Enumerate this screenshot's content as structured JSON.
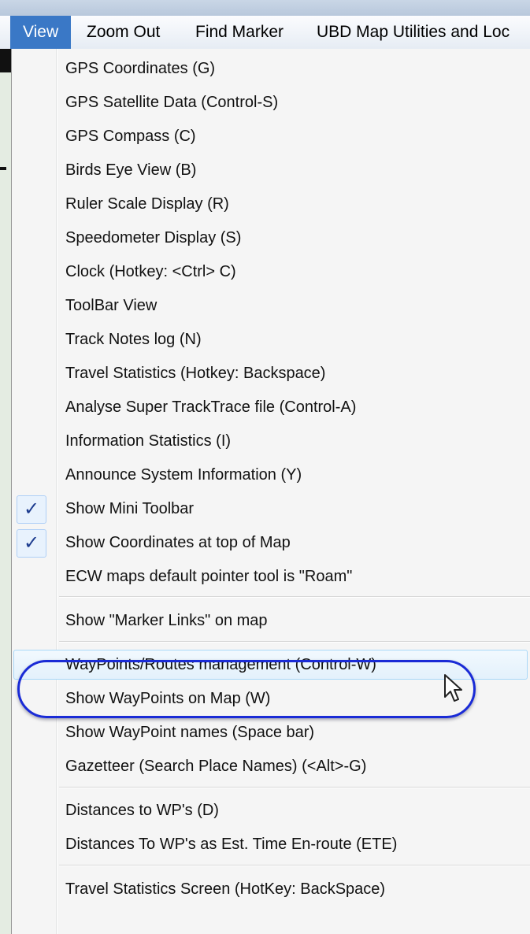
{
  "menubar": {
    "items": [
      {
        "label": "View",
        "active": true
      },
      {
        "label": "Zoom Out"
      },
      {
        "label": "Find Marker"
      },
      {
        "label": "UBD Map Utilities and Loc"
      }
    ]
  },
  "menu": {
    "items": [
      {
        "label": "GPS Coordinates (G)"
      },
      {
        "label": "GPS Satellite Data (Control-S)"
      },
      {
        "label": "GPS Compass (C)"
      },
      {
        "label": "Birds Eye View (B)"
      },
      {
        "label": "Ruler Scale Display (R)"
      },
      {
        "label": "Speedometer Display (S)"
      },
      {
        "label": "Clock (Hotkey: <Ctrl> C)"
      },
      {
        "label": "ToolBar View"
      },
      {
        "label": "Track Notes log (N)"
      },
      {
        "label": "Travel Statistics (Hotkey: Backspace)"
      },
      {
        "label": "Analyse Super TrackTrace file (Control-A)"
      },
      {
        "label": "Information Statistics (I)"
      },
      {
        "label": "Announce System Information (Y)"
      },
      {
        "label": "Show Mini Toolbar",
        "checked": true
      },
      {
        "label": "Show Coordinates at top of Map",
        "checked": true
      },
      {
        "label": "ECW maps default pointer tool is \"Roam\""
      },
      {
        "label": "Show \"Marker Links\" on map"
      },
      {
        "label": "WayPoints/Routes management (Control-W)",
        "hover": true
      },
      {
        "label": "Show WayPoints on Map (W)"
      },
      {
        "label": "Show WayPoint names (Space bar)"
      },
      {
        "label": "Gazetteer (Search Place Names) (<Alt>-G)"
      },
      {
        "label": "Distances to WP's (D)"
      },
      {
        "label": "Distances To WP's as Est. Time En-route (ETE)"
      },
      {
        "label": "Travel Statistics Screen (HotKey: BackSpace)"
      }
    ],
    "check_glyph": "✓"
  },
  "colors": {
    "menubar_active": "#3a78c6",
    "annotation": "#1a2bd6",
    "check": "#1d3c8f"
  }
}
